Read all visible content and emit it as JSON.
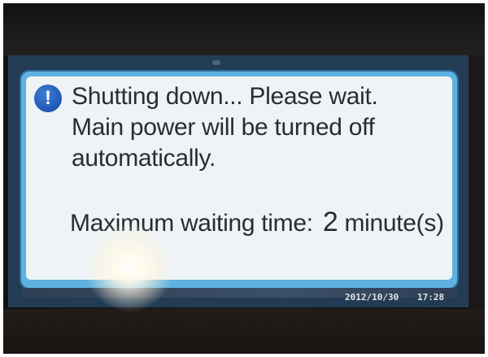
{
  "dialog": {
    "icon": "info-icon",
    "icon_glyph": "!",
    "message_line_1": "Shutting down... Please wait.",
    "message_line_2": "Main power will be turned off",
    "message_line_3": "automatically.",
    "wait_label": "Maximum waiting time:",
    "wait_value": "2",
    "wait_unit": "minute(s)"
  },
  "status_bar": {
    "date": "2012/10/30",
    "time": "17:28"
  },
  "colors": {
    "dialog_border": "#5fb1e1",
    "dialog_background": "#eef3f6",
    "icon_blue": "#1246a7",
    "text": "#2a2d30"
  }
}
